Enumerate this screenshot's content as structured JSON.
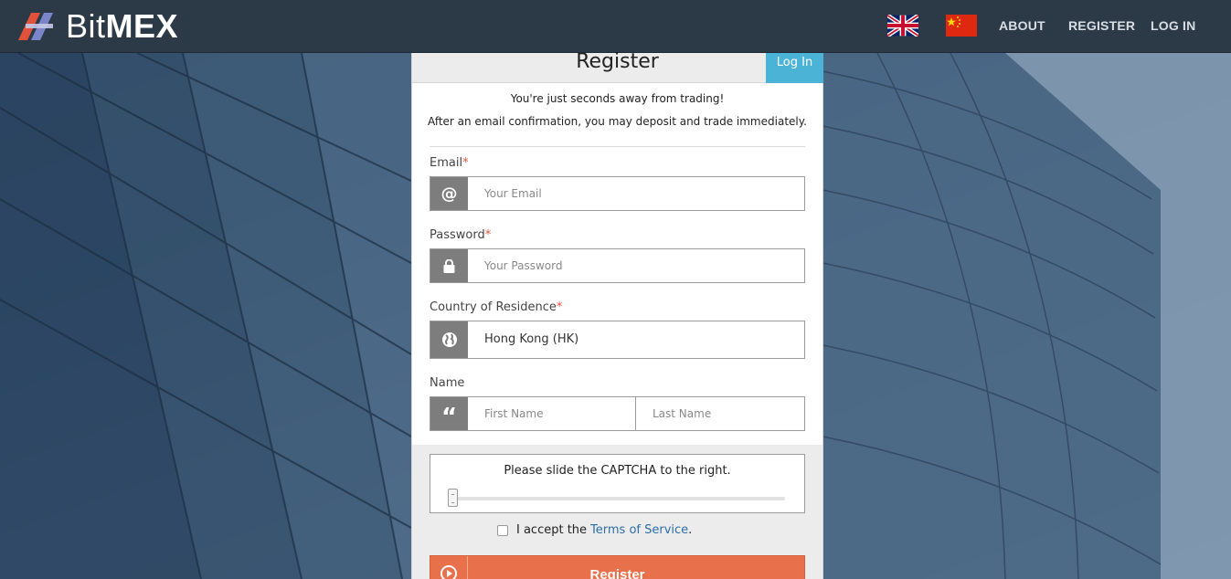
{
  "colors": {
    "header_bg": "#2c3a48",
    "login_tab": "#4bb4d6",
    "register_button": "#e8704a",
    "link": "#2b6ea8",
    "required": "#e0533a"
  },
  "header": {
    "logo_text_light": "Bit",
    "logo_text_bold": "MEX",
    "flags": [
      {
        "name": "uk-flag-icon"
      },
      {
        "name": "cn-flag-icon"
      }
    ],
    "nav": {
      "about": "ABOUT",
      "register": "REGISTER",
      "login": "LOG IN"
    }
  },
  "panel": {
    "title": "Register",
    "login_tab": "Log In",
    "intro_line1": "You're just seconds away from trading!",
    "intro_line2": "After an email confirmation, you may deposit and trade immediately.",
    "email": {
      "label": "Email",
      "required": "*",
      "placeholder": "Your Email",
      "icon": "at-icon"
    },
    "password": {
      "label": "Password",
      "required": "*",
      "placeholder": "Your Password",
      "icon": "lock-icon"
    },
    "country": {
      "label": "Country of Residence",
      "required": "*",
      "value": "Hong Kong (HK)",
      "icon": "globe-icon"
    },
    "name": {
      "label": "Name",
      "first_placeholder": "First Name",
      "last_placeholder": "Last Name",
      "icon": "quote-icon"
    },
    "captcha": {
      "text": "Please slide the CAPTCHA to the right.",
      "progress": 0
    },
    "tos": {
      "prefix": "I accept the",
      "link": "Terms of Service",
      "suffix": ".",
      "checked": false
    },
    "register_button": "Register",
    "register_icon": "play-circle-icon"
  }
}
